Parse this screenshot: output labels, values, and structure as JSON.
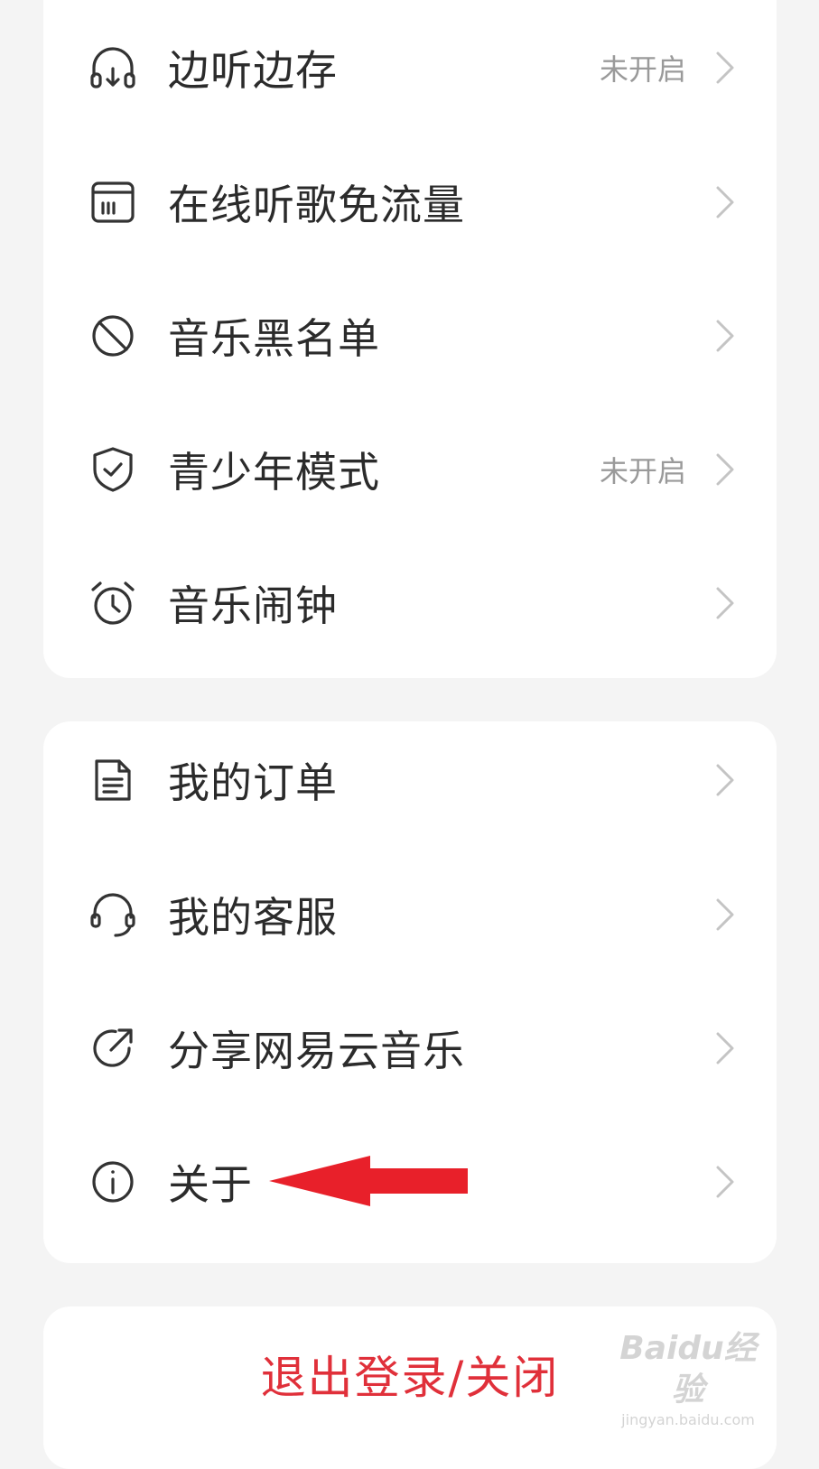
{
  "section1": {
    "items": [
      {
        "label": "边听边存",
        "status": "未开启",
        "icon": "headphones-download-icon"
      },
      {
        "label": "在线听歌免流量",
        "status": "",
        "icon": "sim-card-icon"
      },
      {
        "label": "音乐黑名单",
        "status": "",
        "icon": "block-icon"
      },
      {
        "label": "青少年模式",
        "status": "未开启",
        "icon": "shield-check-icon"
      },
      {
        "label": "音乐闹钟",
        "status": "",
        "icon": "alarm-clock-icon"
      }
    ]
  },
  "section2": {
    "items": [
      {
        "label": "我的订单",
        "icon": "document-icon"
      },
      {
        "label": "我的客服",
        "icon": "headset-icon"
      },
      {
        "label": "分享网易云音乐",
        "icon": "share-icon"
      },
      {
        "label": "关于",
        "icon": "info-icon"
      }
    ]
  },
  "logout": {
    "label": "退出登录/关闭"
  },
  "annotation": {
    "type": "red-arrow",
    "points_to": "关于",
    "color": "#e8202a"
  },
  "watermark": {
    "logo": "Baidu经验",
    "url": "jingyan.baidu.com"
  },
  "colors": {
    "background": "#f4f4f4",
    "card": "#ffffff",
    "text": "#2b2b2b",
    "status": "#9a9a9a",
    "logout": "#e0303a"
  }
}
